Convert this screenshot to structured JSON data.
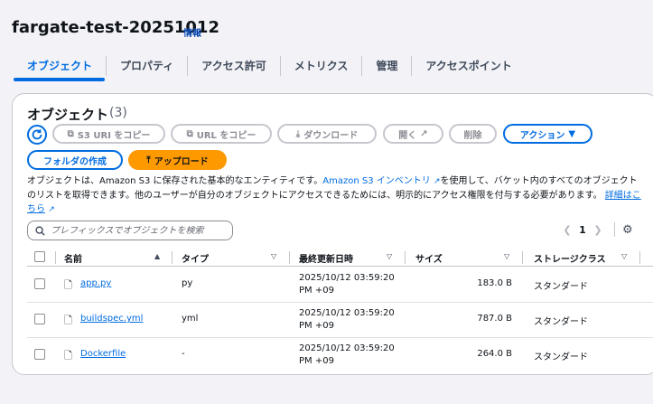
{
  "header": {
    "title": "fargate-test-20251012",
    "info_label": "情報"
  },
  "tabs": [
    {
      "label": "オブジェクト"
    },
    {
      "label": "プロパティ"
    },
    {
      "label": "アクセス許可"
    },
    {
      "label": "メトリクス"
    },
    {
      "label": "管理"
    },
    {
      "label": "アクセスポイント"
    }
  ],
  "panel": {
    "title": "オブジェクト",
    "count": "(3)"
  },
  "toolbar": {
    "copy_s3_uri": "S3 URI をコピー",
    "copy_url": "URL をコピー",
    "download": "ダウンロード",
    "open": "開く",
    "delete": "削除",
    "actions": "アクション",
    "create_folder": "フォルダの作成",
    "upload": "アップロード"
  },
  "description": {
    "part1": "オブジェクトは、Amazon S3 に保存された基本的なエンティティです。",
    "link1": "Amazon S3 インベントリ",
    "part2": "を使用して、バケット内のすべてのオブジェクトのリストを取得できます。他のユーザーが自分のオブジェクトにアクセスできるためには、明示的にアクセス権限を付与する必要があります。",
    "link2": "詳細はこちら"
  },
  "search": {
    "placeholder": "プレフィックスでオブジェクトを検索"
  },
  "pagination": {
    "page": "1"
  },
  "table": {
    "columns": {
      "name": "名前",
      "type": "タイプ",
      "modified": "最終更新日時",
      "size": "サイズ",
      "storage_class": "ストレージクラス"
    },
    "rows": [
      {
        "name": "app.py",
        "type": "py",
        "modified_line1": "2025/10/12 03:59:20",
        "modified_line2": "PM +09",
        "size": "183.0 B",
        "storage_class": "スタンダード"
      },
      {
        "name": "buildspec.yml",
        "type": "yml",
        "modified_line1": "2025/10/12 03:59:20",
        "modified_line2": "PM +09",
        "size": "787.0 B",
        "storage_class": "スタンダード"
      },
      {
        "name": "Dockerfile",
        "type": "-",
        "modified_line1": "2025/10/12 03:59:20",
        "modified_line2": "PM +09",
        "size": "264.0 B",
        "storage_class": "スタンダード"
      }
    ]
  },
  "colors": {
    "accent": "#006ce0",
    "primary_button": "#ff9900",
    "border": "#c6c6cd"
  }
}
